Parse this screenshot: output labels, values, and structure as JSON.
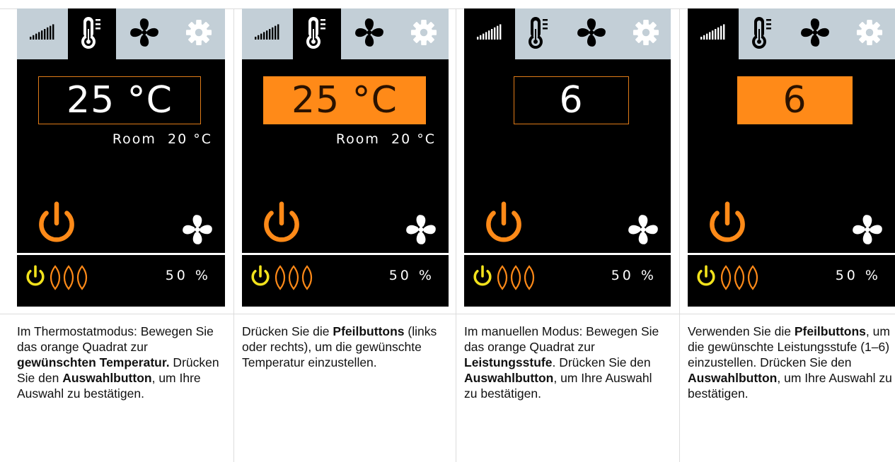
{
  "colors": {
    "accent_orange": "#ff8a18",
    "tab_bar": "#c3cfd7",
    "standby_yellow": "#f2e21c",
    "screen_bg": "#000000"
  },
  "icons": [
    "signal-bars-icon",
    "thermometer-icon",
    "fan-icon",
    "gear-icon",
    "power-icon",
    "heating-flames-icon"
  ],
  "panels": [
    {
      "active_tab": "thermometer",
      "value": "25 °C",
      "value_style": "outline",
      "room_label": "Room  20 °C",
      "power_percent": "50 %",
      "desc": [
        {
          "t": "Im Thermostatmodus: Bewegen Sie das orange Quadrat zur "
        },
        {
          "t": "gewünschten Temperatur.",
          "b": true
        },
        {
          "t": " Drücken Sie den "
        },
        {
          "t": "Auswahlbutton",
          "b": true
        },
        {
          "t": ", um Ihre Auswahl zu bestätigen."
        }
      ]
    },
    {
      "active_tab": "thermometer",
      "value": "25 °C",
      "value_style": "filled",
      "room_label": "Room  20 °C",
      "power_percent": "50 %",
      "desc": [
        {
          "t": "Drücken Sie die "
        },
        {
          "t": "Pfeilbuttons",
          "b": true
        },
        {
          "t": " (links oder rechts), um die gewünschte Temperatur einzustellen."
        }
      ]
    },
    {
      "active_tab": "signal",
      "value": "6",
      "value_style": "outline",
      "room_label": "",
      "power_percent": "50 %",
      "desc": [
        {
          "t": "Im manuellen Modus: Bewegen Sie das orange Quadrat zur "
        },
        {
          "t": "Leistungsstufe",
          "b": true
        },
        {
          "t": ". Drücken Sie den "
        },
        {
          "t": "Auswahlbutton",
          "b": true
        },
        {
          "t": ", um Ihre Auswahl zu bestätigen."
        }
      ]
    },
    {
      "active_tab": "signal",
      "value": "6",
      "value_style": "filled",
      "room_label": "",
      "power_percent": "50 %",
      "desc": [
        {
          "t": "Verwenden Sie die "
        },
        {
          "t": "Pfeilbuttons",
          "b": true
        },
        {
          "t": ", um die gewünschte Leistungsstufe (1–6) einzustellen. Drücken Sie den "
        },
        {
          "t": "Auswahlbutton",
          "b": true
        },
        {
          "t": ", um Ihre Auswahl zu bestätigen."
        }
      ]
    }
  ]
}
